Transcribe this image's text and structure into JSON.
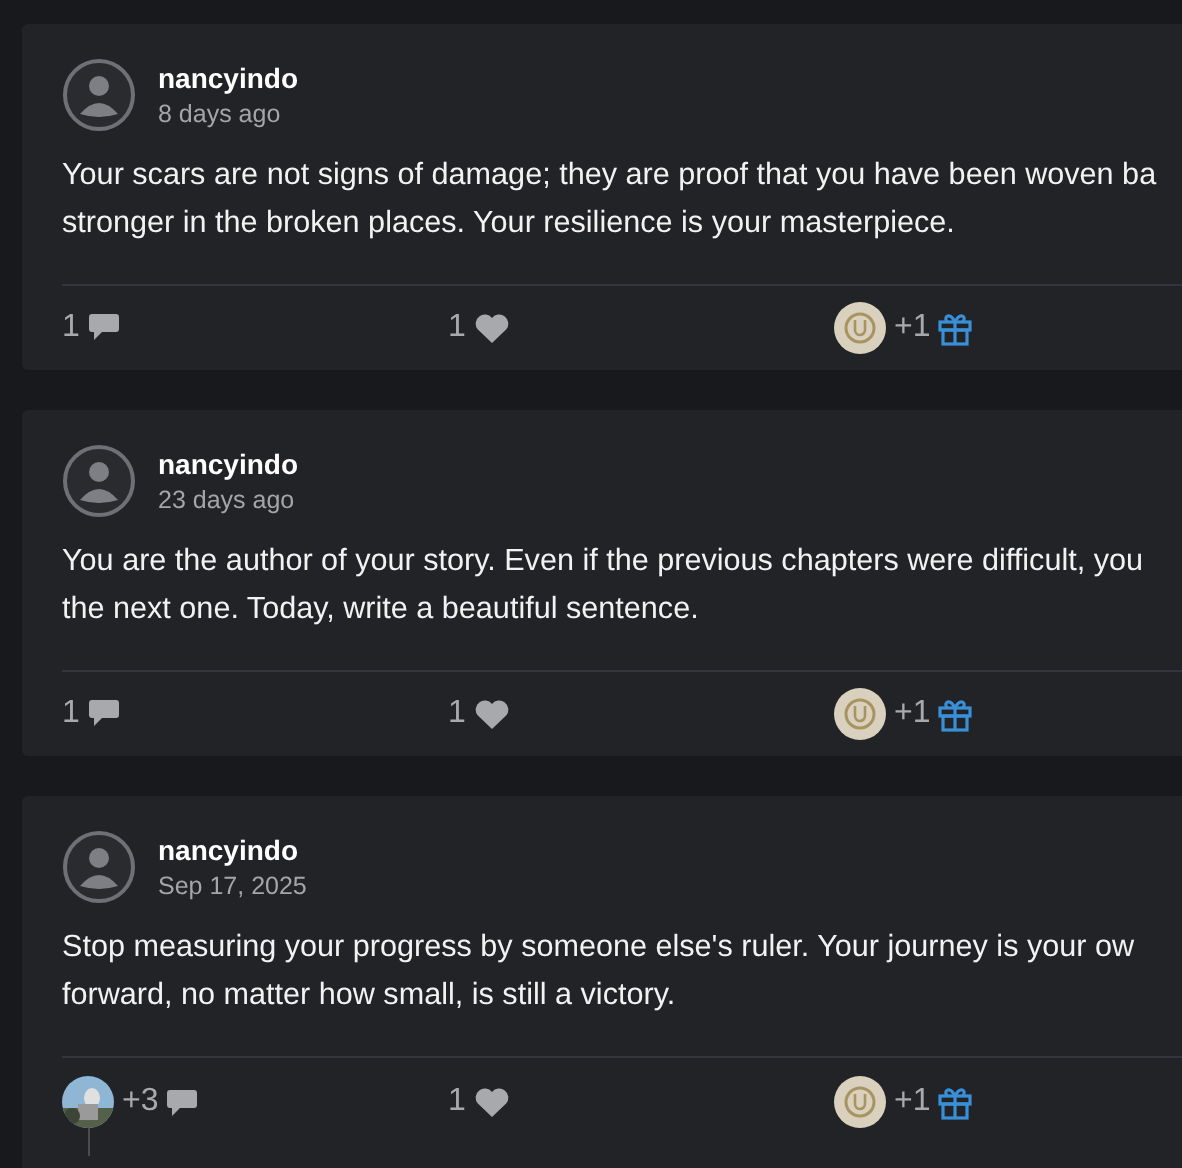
{
  "posts": [
    {
      "author": "nancyindo",
      "time": "8 days ago",
      "body_lines": [
        "Your scars are not signs of damage; they are proof that you have been woven ba",
        "stronger in the broken places. Your resilience is your masterpiece."
      ],
      "comments": {
        "count": "1",
        "commenter_photo": false
      },
      "likes": "1",
      "gifts": "+1",
      "thread_line": false
    },
    {
      "author": "nancyindo",
      "time": "23 days ago",
      "body_lines": [
        "You are the author of your story. Even if the previous chapters were difficult, you",
        "the next one. Today, write a beautiful sentence."
      ],
      "comments": {
        "count": "1",
        "commenter_photo": false
      },
      "likes": "1",
      "gifts": "+1",
      "thread_line": false
    },
    {
      "author": "nancyindo",
      "time": "Sep 17, 2025",
      "body_lines": [
        "Stop measuring your progress by someone else's ruler. Your journey is your ow",
        "forward, no matter how small, is still a victory."
      ],
      "comments": {
        "count": "+3",
        "commenter_photo": true
      },
      "likes": "1",
      "gifts": "+1",
      "thread_line": true
    }
  ]
}
